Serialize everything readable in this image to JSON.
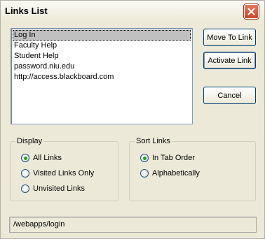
{
  "window": {
    "title": "Links List"
  },
  "links": [
    {
      "label": "Log In",
      "selected": true
    },
    {
      "label": "Faculty Help",
      "selected": false
    },
    {
      "label": "Student Help",
      "selected": false
    },
    {
      "label": "password.niu.edu",
      "selected": false
    },
    {
      "label": "http://access.blackboard.com",
      "selected": false
    }
  ],
  "buttons": {
    "move_to_link": "Move To Link",
    "activate_link": "Activate Link",
    "cancel": "Cancel"
  },
  "display_group": {
    "label": "Display",
    "options": [
      {
        "label": "All Links",
        "checked": true
      },
      {
        "label": "Visited Links Only",
        "checked": false
      },
      {
        "label": "Unvisited Links",
        "checked": false
      }
    ]
  },
  "sort_group": {
    "label": "Sort Links",
    "options": [
      {
        "label": "In Tab Order",
        "checked": true
      },
      {
        "label": "Alphabetically",
        "checked": false
      }
    ]
  },
  "status": {
    "url": "/webapps/login"
  },
  "icons": {
    "close": "close-icon"
  },
  "colors": {
    "close_button": "#c9472a",
    "radio_dot": "#21a121",
    "selection": "#c0c0c0"
  }
}
